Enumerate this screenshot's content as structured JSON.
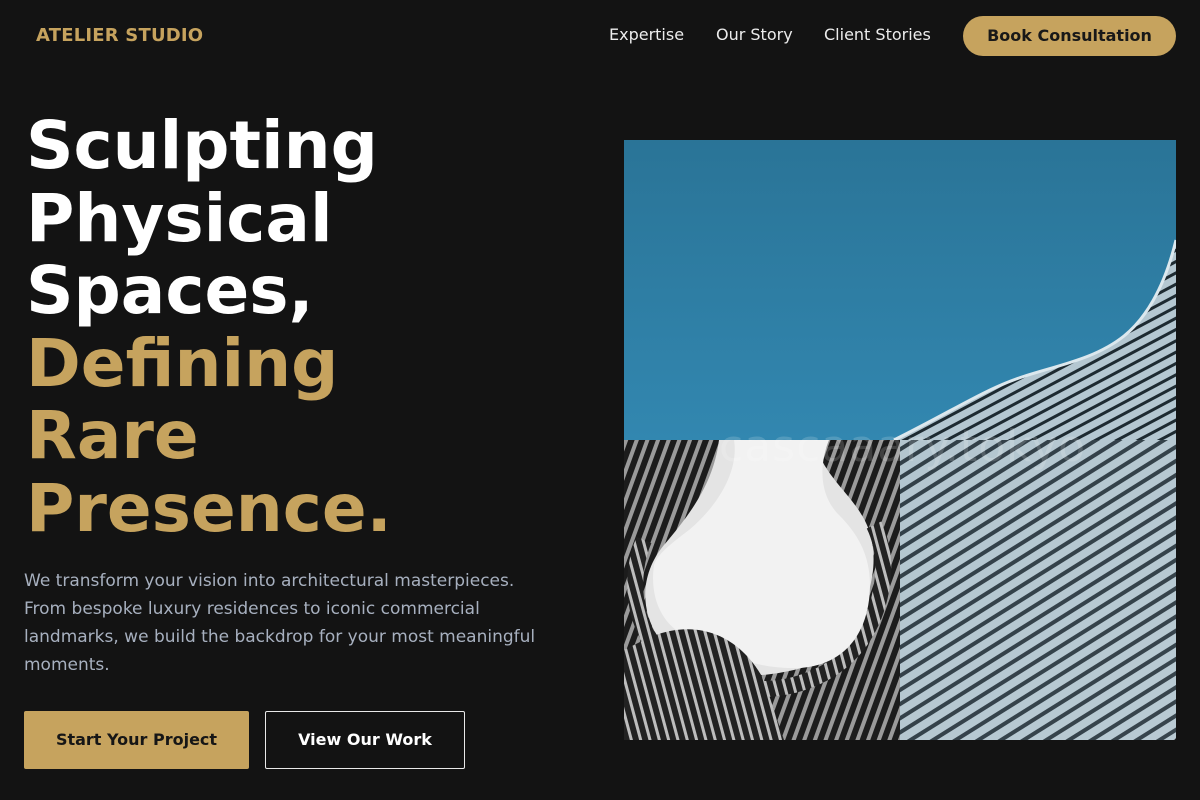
{
  "nav": {
    "brand": "ATELIER STUDIO",
    "links": [
      {
        "label": "Expertise"
      },
      {
        "label": "Our Story"
      },
      {
        "label": "Client Stories"
      }
    ],
    "cta_label": "Book Consultation"
  },
  "hero": {
    "title_lines": [
      "Sculpting",
      "Physical",
      "Spaces,"
    ],
    "accent_lines": [
      "Defining",
      "Rare",
      "Presence."
    ],
    "description": "We transform your vision into architectural masterpieces. From bespoke luxury residences to iconic commercial landmarks, we build the backdrop for your most meaningful moments.",
    "primary_button": "Start Your Project",
    "secondary_button": "View Our Work"
  },
  "gallery": {
    "watermark": "cascaaary.tokyo",
    "images": [
      {
        "subject": "blue sky with curved building facade"
      },
      {
        "subject": "black and white curved tower looking up"
      },
      {
        "subject": "light blue woven facade pattern"
      }
    ]
  },
  "colors": {
    "background": "#131313",
    "accent": "#c6a35e",
    "text": "#ffffff",
    "muted_text": "#a7b0bf"
  }
}
